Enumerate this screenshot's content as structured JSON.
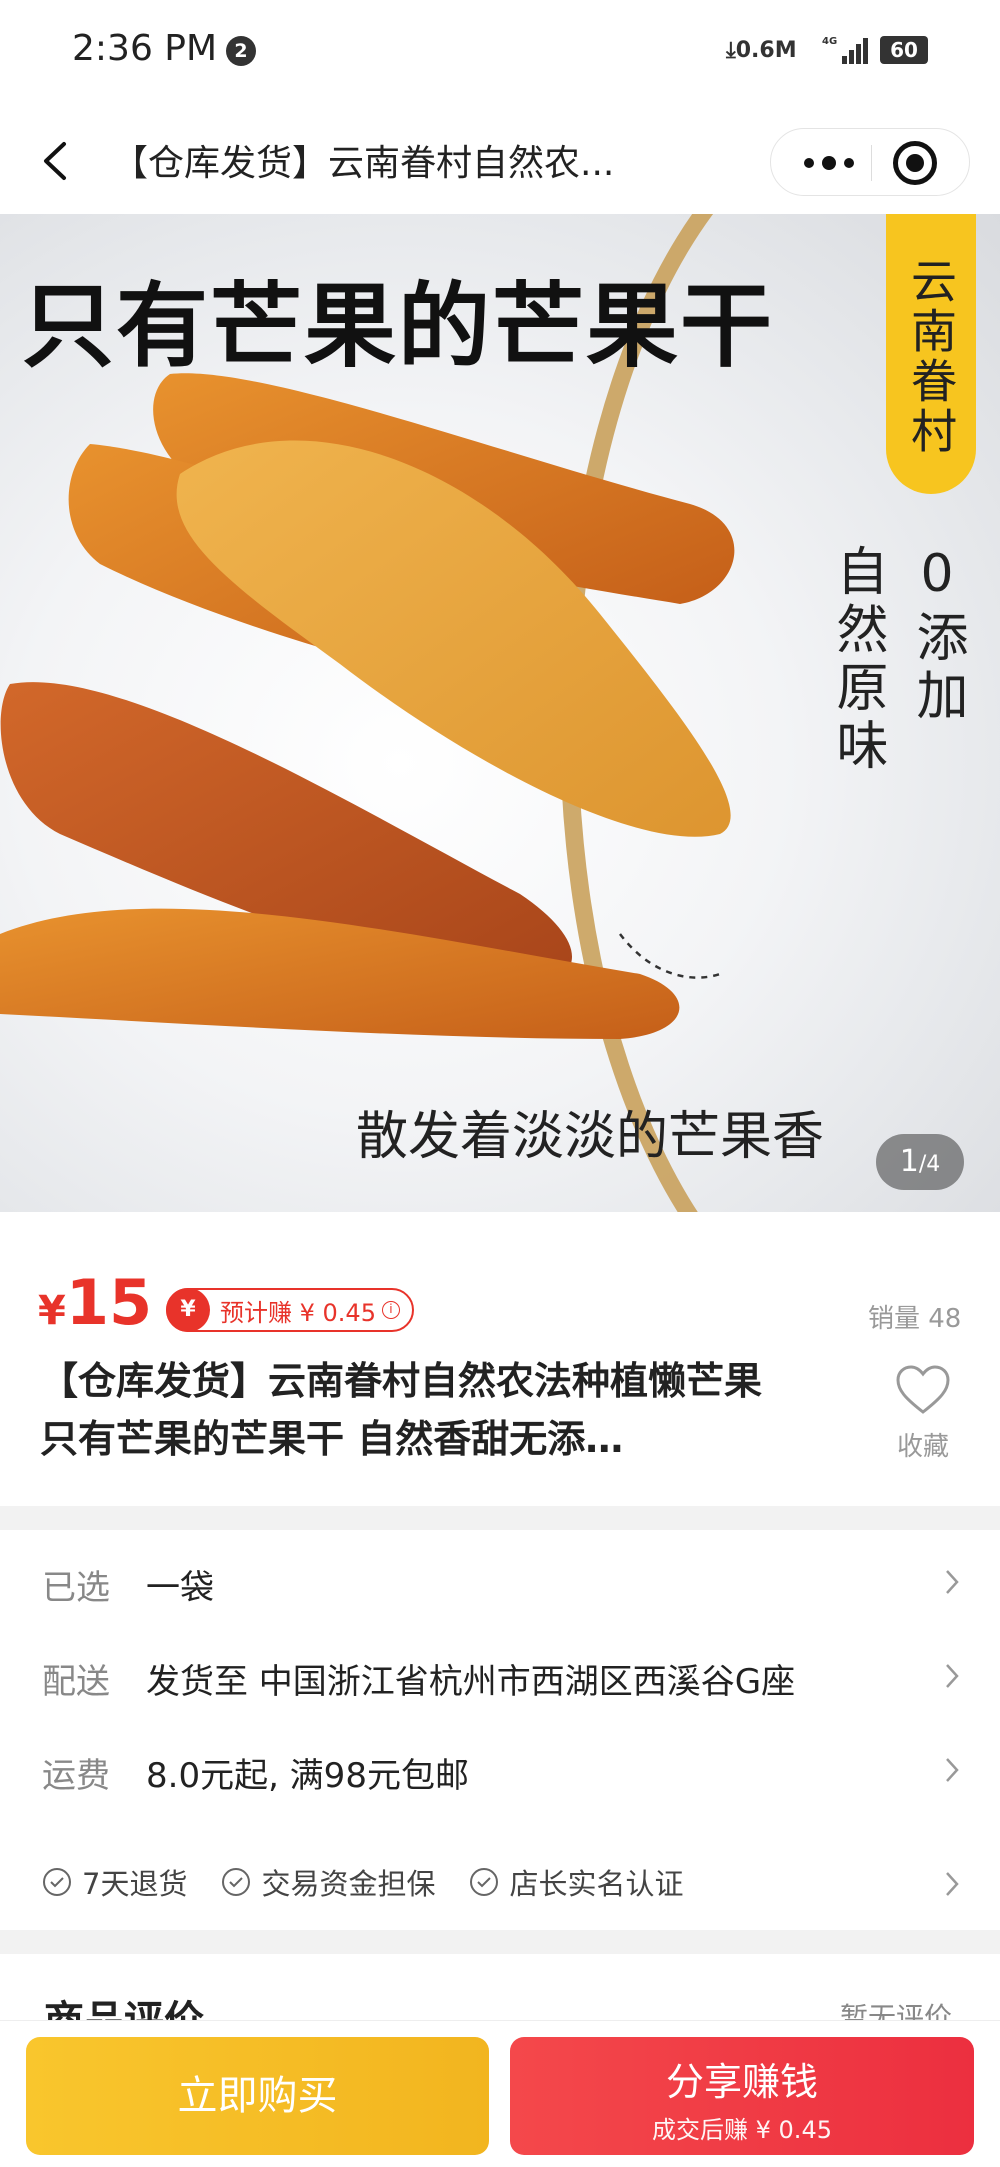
{
  "status_bar": {
    "time": "2:36 PM",
    "notification_count": "2",
    "net_speed": "0.6M",
    "network": "4G",
    "battery": "60"
  },
  "nav": {
    "title": "【仓库发货】云南眷村自然农..."
  },
  "gallery": {
    "headline": "只有芒果的芒果干",
    "brand_tag": "云南眷村",
    "tag_zero_additive": "0添加",
    "tag_natural": "自然原味",
    "caption": "散发着淡淡的芒果香",
    "page_current": "1",
    "page_total": "/4"
  },
  "product": {
    "currency": "¥",
    "price": "15",
    "earn_coin": "¥",
    "earn_label": "预计赚 ¥ 0.45",
    "sales": "销量 48",
    "title": "【仓库发货】云南眷村自然农法种植懒芒果 只有芒果的芒果干 自然香甜无添…",
    "favorite_label": "收藏"
  },
  "specs": [
    {
      "key": "已选",
      "value": "一袋"
    },
    {
      "key": "配送",
      "value": "发货至 中国浙江省杭州市西湖区西溪谷G座"
    },
    {
      "key": "运费",
      "value": "8.0元起, 满98元包邮"
    }
  ],
  "guarantees": [
    "7天退货",
    "交易资金担保",
    "店长实名认证"
  ],
  "reviews": {
    "title": "商品评价",
    "more": "暂无评价"
  },
  "actions": {
    "buy": "立即购买",
    "share": "分享赚钱",
    "share_sub": "成交后赚 ¥ 0.45"
  },
  "colors": {
    "price_red": "#e8332a",
    "buy_yellow": "#f9c62d",
    "share_red": "#f4484b",
    "brand_yellow": "#f7c51f"
  }
}
